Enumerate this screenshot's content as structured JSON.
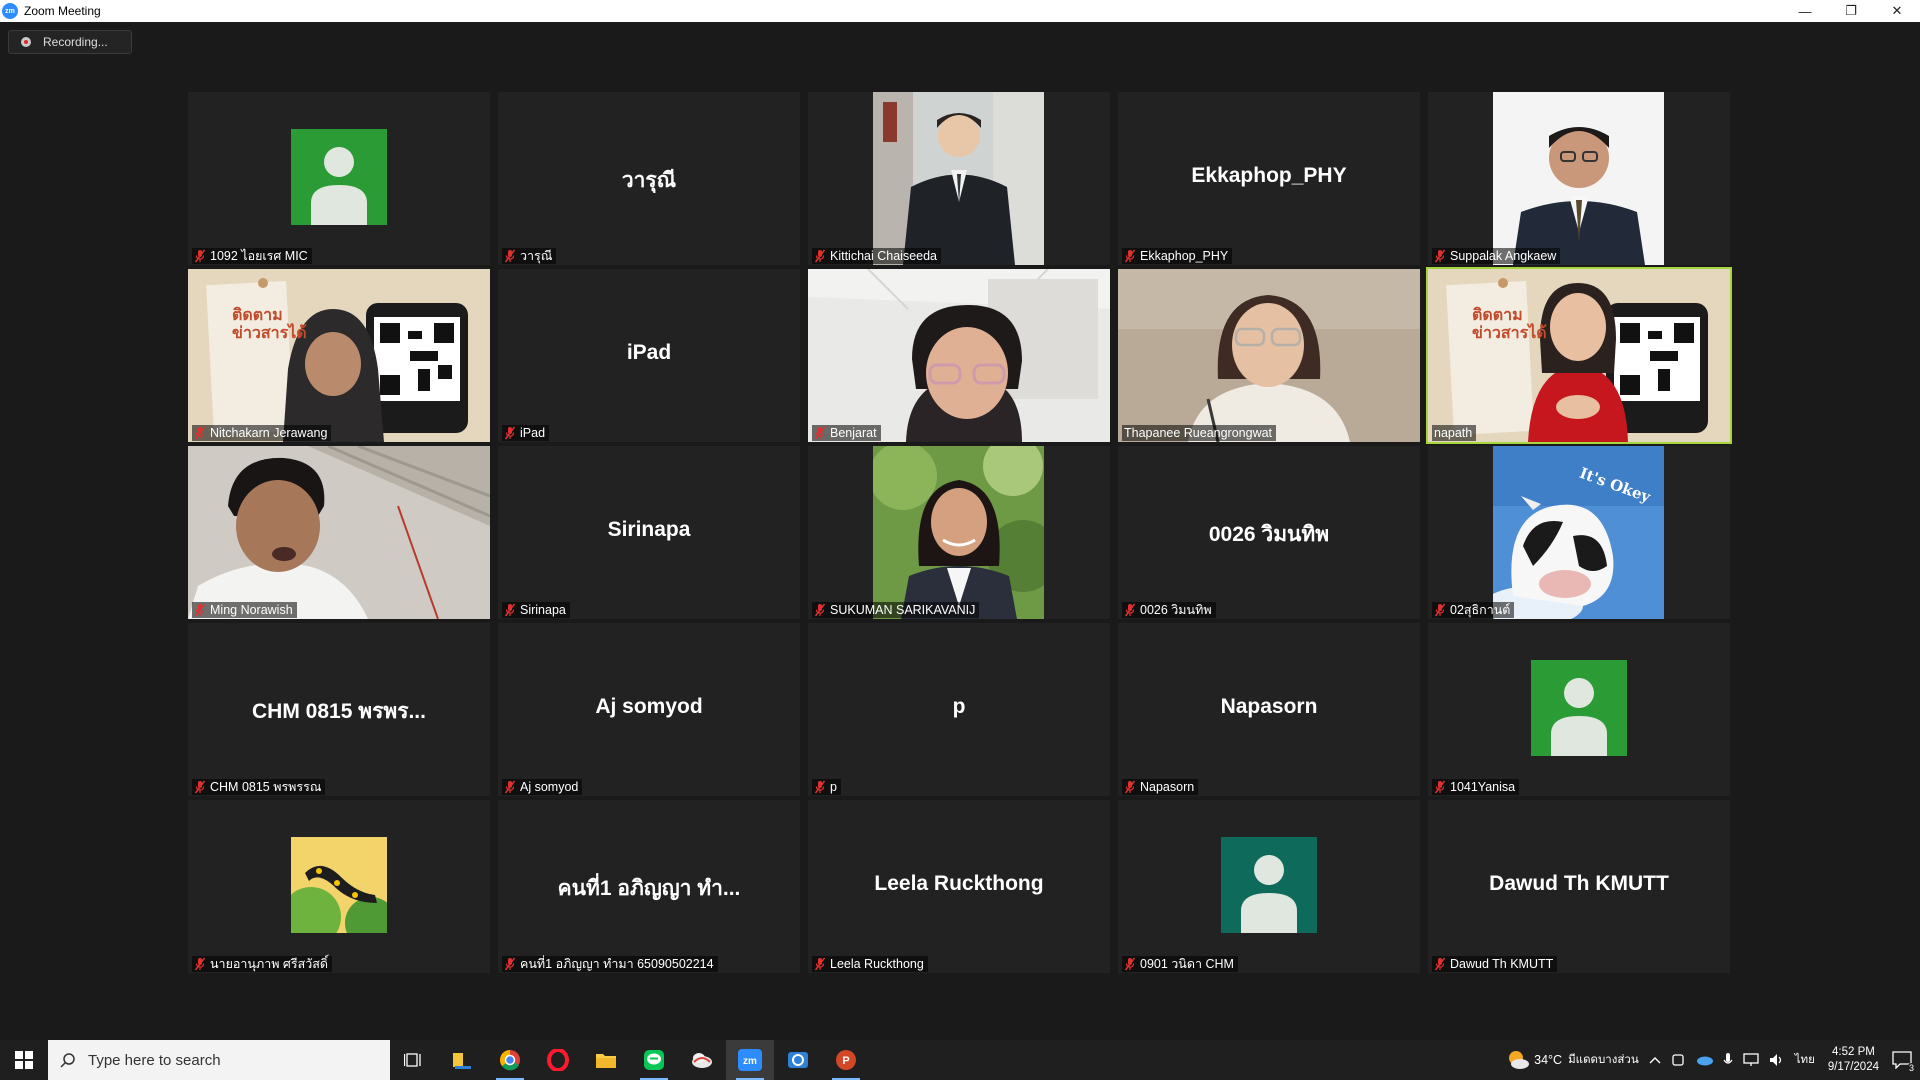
{
  "window": {
    "title": "Zoom Meeting",
    "logo_text": "zm",
    "minimize": "—",
    "restore": "❐",
    "close": "✕"
  },
  "recording": {
    "label": "Recording..."
  },
  "tiles": {
    "t1": {
      "label": "1092 ไอยเรศ MIC"
    },
    "t2": {
      "center": "วารุณี",
      "label": "วารุณี"
    },
    "t3": {
      "label": "Kittichai Chaiseeda"
    },
    "t4": {
      "center": "Ekkaphop_PHY",
      "label": "Ekkaphop_PHY"
    },
    "t5": {
      "label": "Suppalak Angkaew"
    },
    "t6": {
      "label": "Nitchakarn Jerawang",
      "poster_title_1": "ติดตาม",
      "poster_title_2": "ข่าวสารได้"
    },
    "t7": {
      "center": "iPad",
      "label": "iPad"
    },
    "t8": {
      "label": "Benjarat"
    },
    "t9": {
      "label": "Thapanee Rueangrongwat"
    },
    "t10": {
      "label": "napath",
      "poster_title_1": "ติดตาม",
      "poster_title_2": "ข่าวสารได้"
    },
    "t11": {
      "label": "Ming Norawish"
    },
    "t12": {
      "center": "Sirinapa",
      "label": "Sirinapa"
    },
    "t13": {
      "label": "SUKUMAN SARIKAVANIJ"
    },
    "t14": {
      "center": "0026 วิมนทิพ",
      "label": "0026 วิมนทิพ"
    },
    "t15": {
      "label": "02สุธิกานต์",
      "sticker_text": "It's Okey"
    },
    "t16": {
      "center": "CHM 0815 พรพร...",
      "label": "CHM 0815 พรพรรณ"
    },
    "t17": {
      "center": "Aj somyod",
      "label": "Aj somyod"
    },
    "t18": {
      "center": "p",
      "label": "p"
    },
    "t19": {
      "center": "Napasorn",
      "label": "Napasorn"
    },
    "t20": {
      "label": "1041Yanisa"
    },
    "t21": {
      "label": "นายอานุภาพ ศรีสวัสดิ์"
    },
    "t22": {
      "center": "คนที่1 อภิญญา ทำ...",
      "label": "คนที่1 อภิญญา ทำมา 65090502214"
    },
    "t23": {
      "center": "Leela Ruckthong",
      "label": "Leela Ruckthong"
    },
    "t24": {
      "label": "0901 วนิดา CHM"
    },
    "t25": {
      "center": "Dawud Th KMUTT",
      "label": "Dawud Th KMUTT"
    }
  },
  "taskbar": {
    "search_placeholder": "Type here to search",
    "weather_temp": "34°C",
    "weather_desc": "มีแดดบางส่วน",
    "language": "ไทย",
    "time": "4:52 PM",
    "date": "9/17/2024",
    "notification_count": "3"
  },
  "colors": {
    "background": "#1a1a1a",
    "tile": "#222222",
    "active_speaker": "#a5d63d",
    "muted_icon": "#e0312f",
    "avatar_green": "#2b9b36",
    "avatar_teal": "#0e6b5c"
  }
}
